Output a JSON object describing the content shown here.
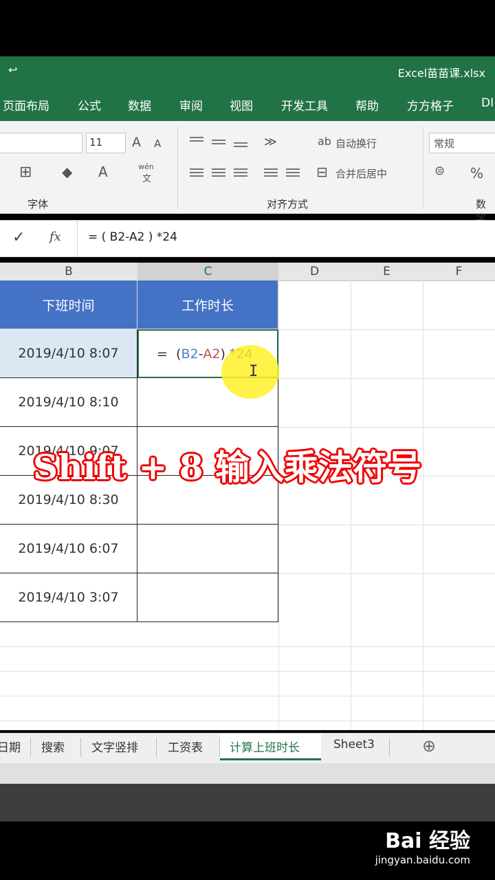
{
  "app": {
    "qat_symbol": "↩",
    "filename": "Excel苗苗课.xlsx"
  },
  "ribbon_tabs": [
    "页面布局",
    "公式",
    "数据",
    "审阅",
    "视图",
    "开发工具",
    "帮助",
    "方方格子",
    "DI"
  ],
  "ribbon": {
    "font_size": "11",
    "font_group_label": "字体",
    "align_group_label": "对齐方式",
    "number_group_label": "数字",
    "wrap_text": "自动换行",
    "merge_center": "合并后居中",
    "number_format": "常规",
    "percent": "%",
    "grow_font": "A",
    "shrink_font": "A",
    "font_color": "A",
    "wen": "wén",
    "wen_char": "文"
  },
  "formula_bar": {
    "check": "✓",
    "fx": "fx",
    "formula": "= ( B2-A2 ) *24"
  },
  "columns": [
    "B",
    "C",
    "D",
    "E",
    "F"
  ],
  "table": {
    "headers": [
      "下班时间",
      "工作时长"
    ],
    "rows": [
      "2019/4/10 8:07",
      "2019/4/10 8:10",
      "2019/4/10 9:07",
      "2019/4/10 8:30",
      "2019/4/10 6:07",
      "2019/4/10 3:07"
    ],
    "editing": {
      "eq": "=",
      "paren_open": "(",
      "ref1": "B2",
      "minus": "-",
      "ref2": "A2",
      "paren_close": ")",
      "tail": "*24"
    }
  },
  "overlay_caption": "Shift + 8 输入乘法符号",
  "sheet_tabs": [
    "日期",
    "搜索",
    "文字竖排",
    "工资表",
    "计算上班时长",
    "Sheet3"
  ],
  "add_sheet": "⊕",
  "watermark": {
    "logo": "Bai 经验",
    "url": "jingyan.baidu.com"
  },
  "colors": {
    "excel_green": "#217346",
    "header_blue": "#4472c4",
    "ref_blue": "#4a7fc8",
    "ref_red": "#c0504d"
  }
}
